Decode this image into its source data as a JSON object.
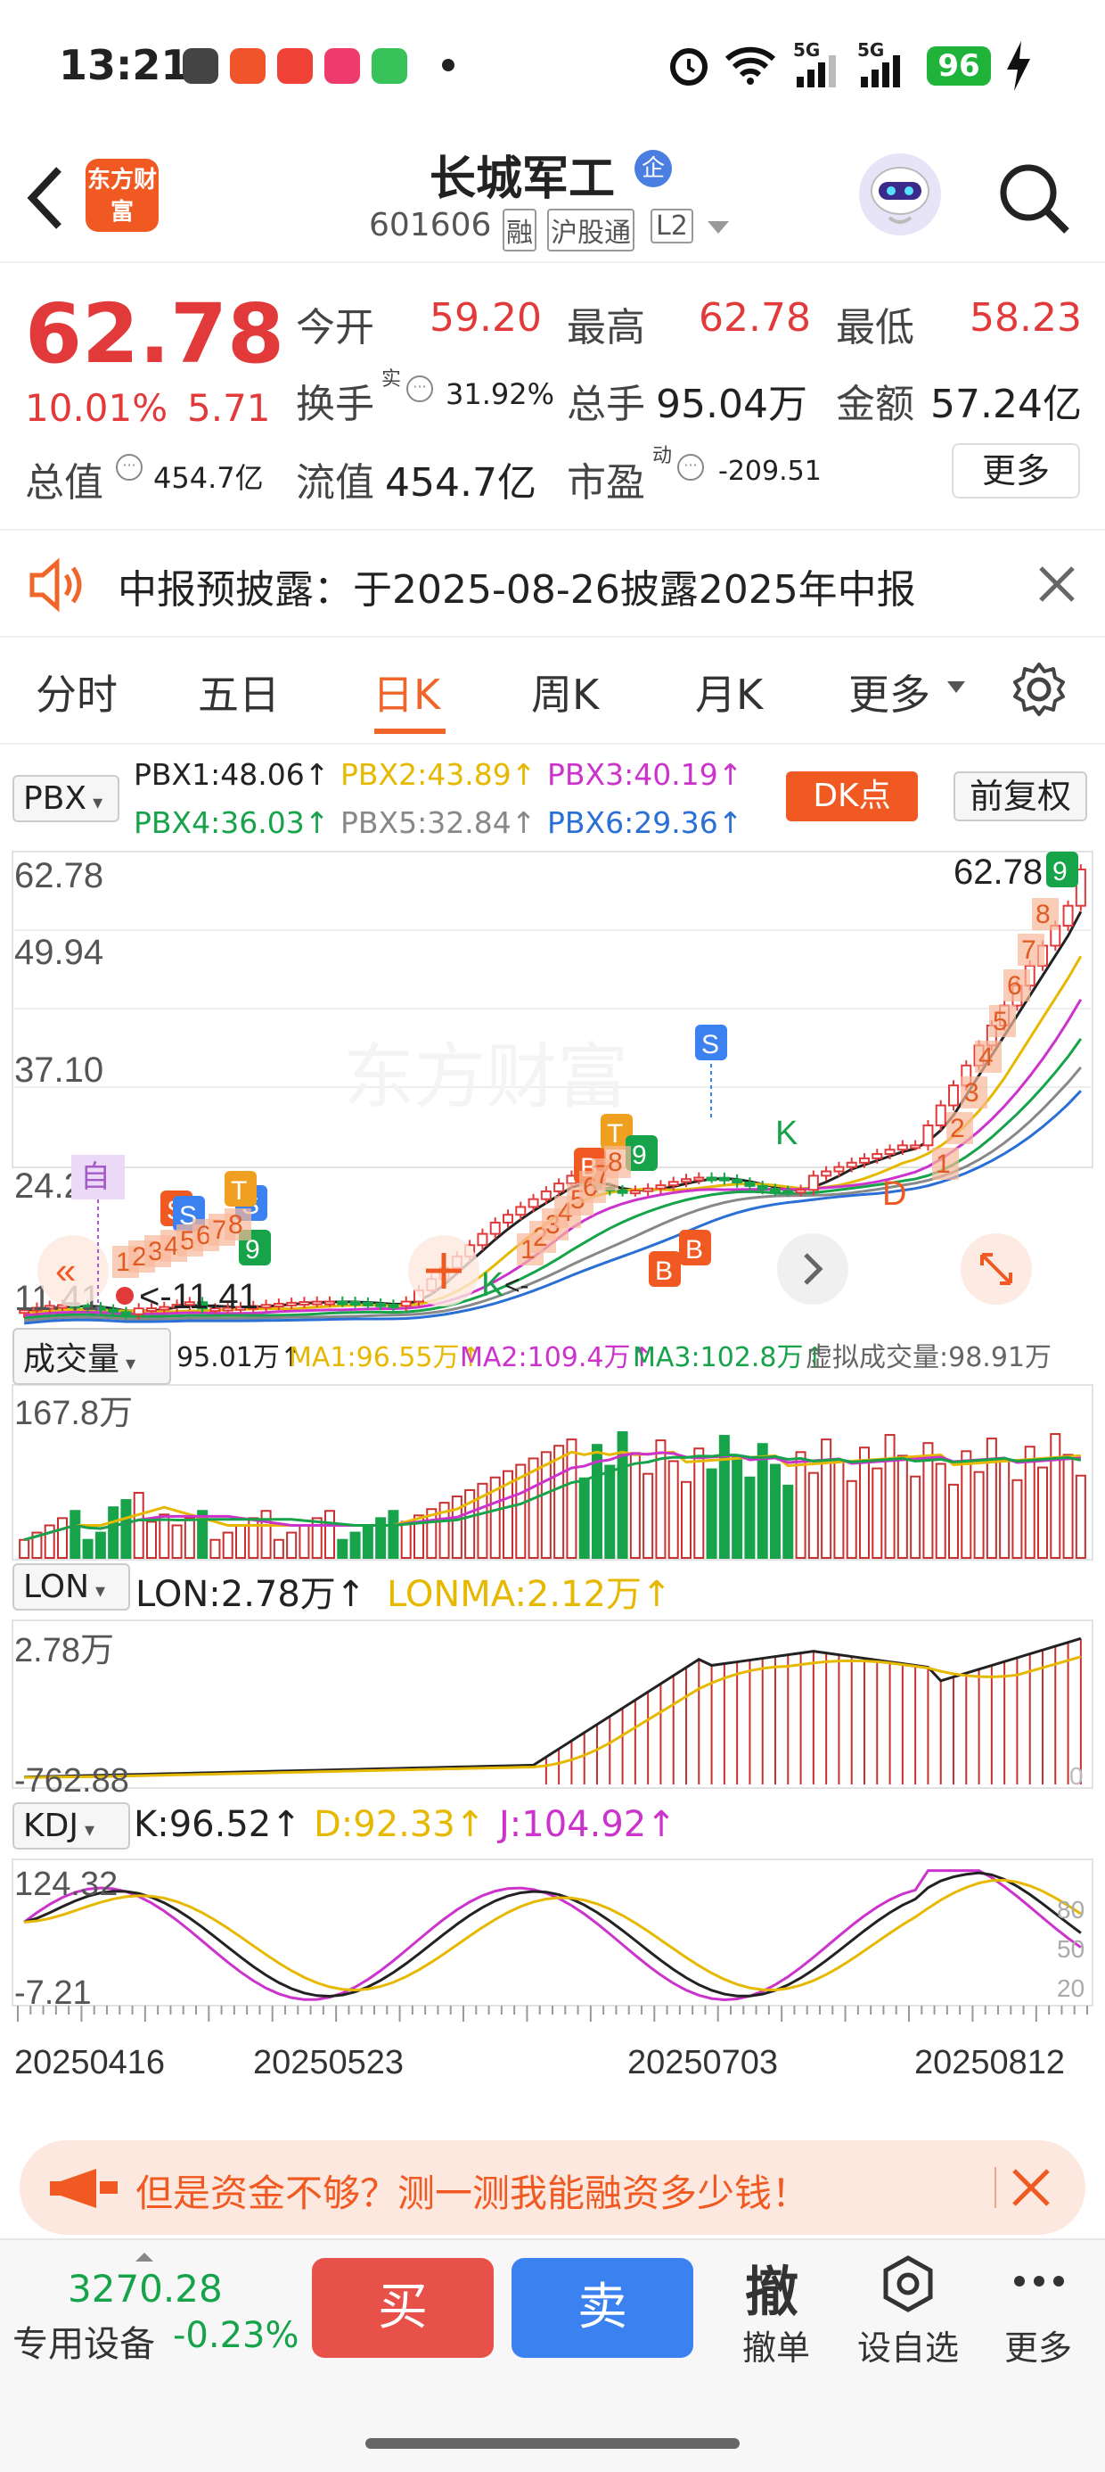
{
  "status": {
    "time": "13:21",
    "battery": "96",
    "net1": "5G",
    "net2": "5G"
  },
  "header": {
    "brand": "东方财富",
    "title": "长城军工",
    "badge": "企",
    "code": "601606",
    "tags": [
      "融",
      "沪股通",
      "L2"
    ]
  },
  "quote": {
    "price": "62.78",
    "pct": "10.01%",
    "chg": "5.71",
    "open_label": "今开",
    "open": "59.20",
    "high_label": "最高",
    "high": "62.78",
    "low_label": "最低",
    "low": "58.23",
    "turnover_label": "换手",
    "turnover_sup": "实",
    "turnover": "31.92%",
    "volume_label": "总手",
    "volume": "95.04万",
    "amount_label": "金额",
    "amount": "57.24亿",
    "mcap_label": "总值",
    "mcap": "454.7亿",
    "float_label": "流值",
    "float": "454.7亿",
    "pe_label": "市盈",
    "pe_sup": "动",
    "pe": "-209.51",
    "more": "更多"
  },
  "notice": {
    "text": "中报预披露：于2025-08-26披露2025年中报"
  },
  "tabs": [
    "分时",
    "五日",
    "日K",
    "周K",
    "月K",
    "更多"
  ],
  "active_tab": "日K",
  "pbx": {
    "selector": "PBX",
    "items": [
      "PBX1:48.06↑",
      "PBX2:43.89↑",
      "PBX3:40.19↑",
      "PBX4:36.03↑",
      "PBX5:32.84↑",
      "PBX6:29.36↑"
    ],
    "colors": [
      "#222222",
      "#e6b800",
      "#cc33cc",
      "#16a34a",
      "#888888",
      "#2a6fd6"
    ],
    "dk": "DK点",
    "fq": "前复权"
  },
  "price_axis": [
    "62.78",
    "49.94",
    "37.10",
    "24.25",
    "11.41"
  ],
  "price_marks": {
    "top": "62.78",
    "bottom": "<-11.41",
    "watermark": "东方财富",
    "mark_label": "自",
    "kd_labels": [
      "K",
      "D",
      "K"
    ],
    "kd_marks": [
      "<-"
    ]
  },
  "signal_marks": {
    "s_marks": [
      "S",
      "S",
      "S"
    ],
    "b_marks": [
      "B",
      "B",
      "B"
    ],
    "t_marks": [
      "T",
      "T"
    ],
    "nine": [
      "9",
      "9",
      "9"
    ],
    "count_top": [
      "1",
      "2",
      "3",
      "4",
      "5",
      "6",
      "7",
      "8",
      "9"
    ],
    "count_mid": [
      "1",
      "2",
      "3",
      "4",
      "5",
      "6",
      "7",
      "8"
    ],
    "count_left": [
      "1",
      "2",
      "3",
      "4",
      "5",
      "6",
      "7",
      "8"
    ],
    "count_right": [
      "1",
      "2",
      "3",
      "4",
      "5",
      "6",
      "7",
      "8"
    ]
  },
  "vol": {
    "selector": "成交量",
    "items": [
      "95.01万↑",
      "MA1:96.55万↑",
      "MA2:109.4万↑",
      "MA3:102.8万↑",
      "虚拟成交量:98.91万"
    ],
    "colors": [
      "#222",
      "#e6b800",
      "#cc33cc",
      "#16a34a",
      "#666"
    ],
    "axis": "167.8万"
  },
  "lon": {
    "selector": "LON",
    "items": [
      "LON:2.78万↑",
      "LONMA:2.12万↑"
    ],
    "colors": [
      "#222",
      "#e6b800"
    ],
    "axis_top": "2.78万",
    "axis_bottom": "-762.88",
    "zero": "0"
  },
  "kdj": {
    "selector": "KDJ",
    "items": [
      "K:96.52↑",
      "D:92.33↑",
      "J:104.92↑"
    ],
    "colors": [
      "#222",
      "#e6b800",
      "#cc33cc"
    ],
    "axis_top": "124.32",
    "axis_bottom": "-7.21",
    "levels": [
      "80",
      "50",
      "20"
    ]
  },
  "dates": [
    "20250416",
    "20250523",
    "20250703",
    "20250812"
  ],
  "banner": {
    "text": "但是资金不够？测一测我能融资多少钱！"
  },
  "bottom": {
    "index_value": "3270.28",
    "index_label": "专用设备",
    "index_pct": "-0.23%",
    "buy": "买",
    "sell": "卖",
    "cancel_glyph": "撤",
    "cancel": "撤单",
    "watch": "设自选",
    "more": "更多"
  }
}
